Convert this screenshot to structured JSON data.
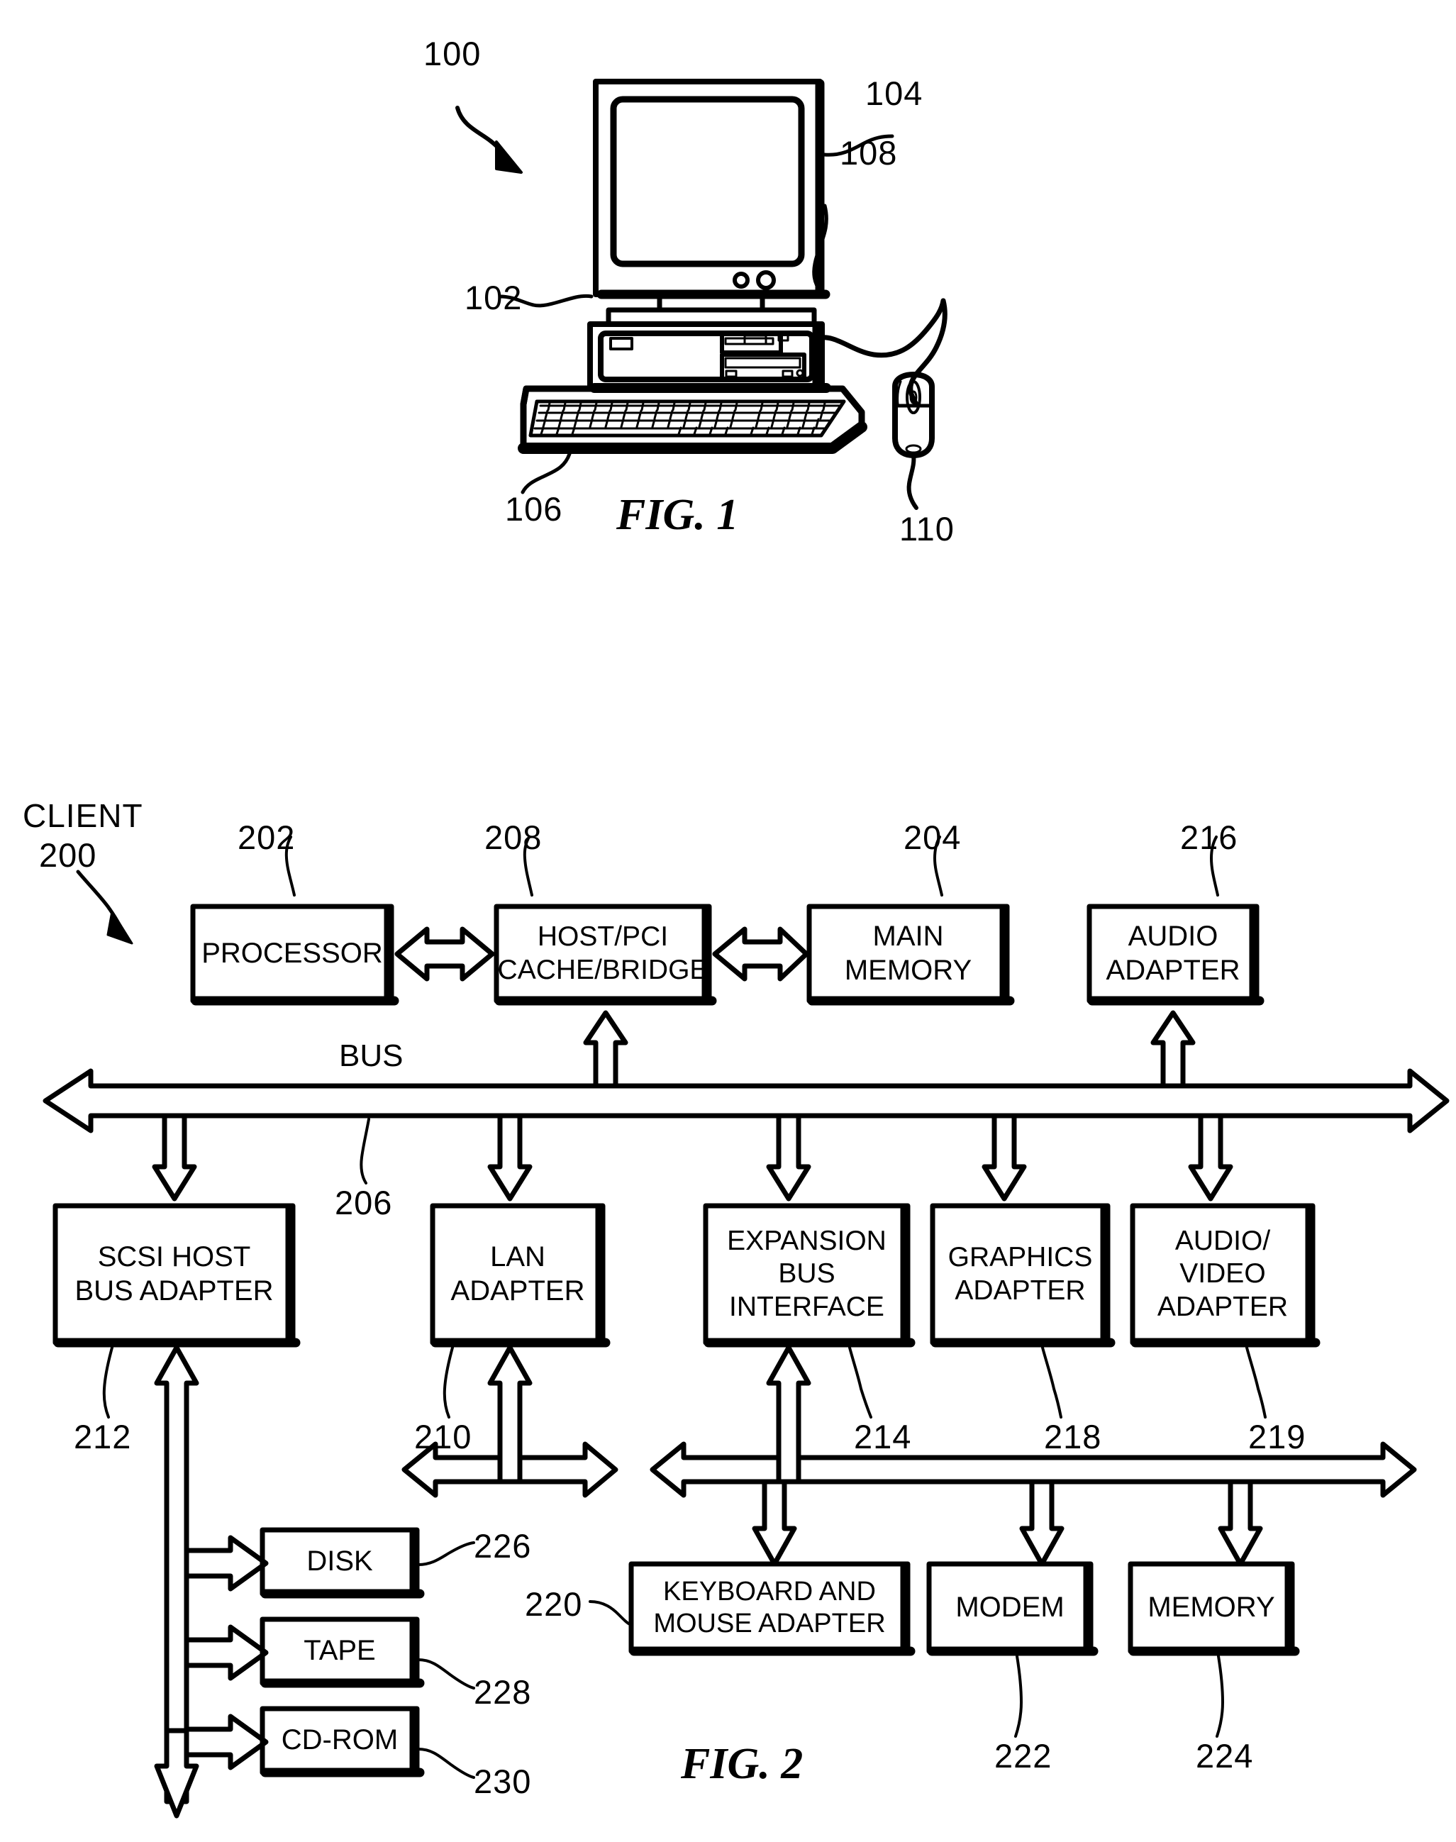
{
  "figures": [
    {
      "id": "fig1",
      "caption": "FIG. 1",
      "title": "Data processing system pictorial representation",
      "callouts": [
        {
          "ref": "100",
          "target": "data-processing-system"
        },
        {
          "ref": "104",
          "target": "display-monitor"
        },
        {
          "ref": "108",
          "target": "media-drives"
        },
        {
          "ref": "102",
          "target": "system-unit"
        },
        {
          "ref": "106",
          "target": "keyboard"
        },
        {
          "ref": "110",
          "target": "mouse"
        }
      ]
    },
    {
      "id": "fig2",
      "caption": "FIG. 2",
      "title": "Client data processing system block diagram",
      "system_label": "CLIENT",
      "system_ref": "200",
      "bus_label": "BUS",
      "blocks": [
        {
          "ref": "202",
          "label": "PROCESSOR",
          "name": "processor"
        },
        {
          "ref": "208",
          "label": "HOST/PCI\nCACHE/BRIDGE",
          "name": "host-pci-cache-bridge"
        },
        {
          "ref": "204",
          "label": "MAIN\nMEMORY",
          "name": "main-memory"
        },
        {
          "ref": "216",
          "label": "AUDIO\nADAPTER",
          "name": "audio-adapter"
        },
        {
          "ref": "212",
          "label": "SCSI HOST\nBUS ADAPTER",
          "name": "scsi-host-bus-adapter"
        },
        {
          "ref": "210",
          "label": "LAN\nADAPTER",
          "name": "lan-adapter"
        },
        {
          "ref": "214",
          "label": "EXPANSION\nBUS\nINTERFACE",
          "name": "expansion-bus-interface"
        },
        {
          "ref": "218",
          "label": "GRAPHICS\nADAPTER",
          "name": "graphics-adapter"
        },
        {
          "ref": "219",
          "label": "AUDIO/\nVIDEO\nADAPTER",
          "name": "audio-video-adapter"
        },
        {
          "ref": "226",
          "label": "DISK",
          "name": "disk"
        },
        {
          "ref": "228",
          "label": "TAPE",
          "name": "tape"
        },
        {
          "ref": "230",
          "label": "CD-ROM",
          "name": "cd-rom"
        },
        {
          "ref": "220",
          "label": "KEYBOARD AND\nMOUSE ADAPTER",
          "name": "keyboard-and-mouse-adapter"
        },
        {
          "ref": "222",
          "label": "MODEM",
          "name": "modem"
        },
        {
          "ref": "224",
          "label": "MEMORY",
          "name": "memory"
        }
      ],
      "bus_ref": "206"
    }
  ],
  "colors": {
    "ink": "#000000",
    "paper": "#ffffff"
  }
}
